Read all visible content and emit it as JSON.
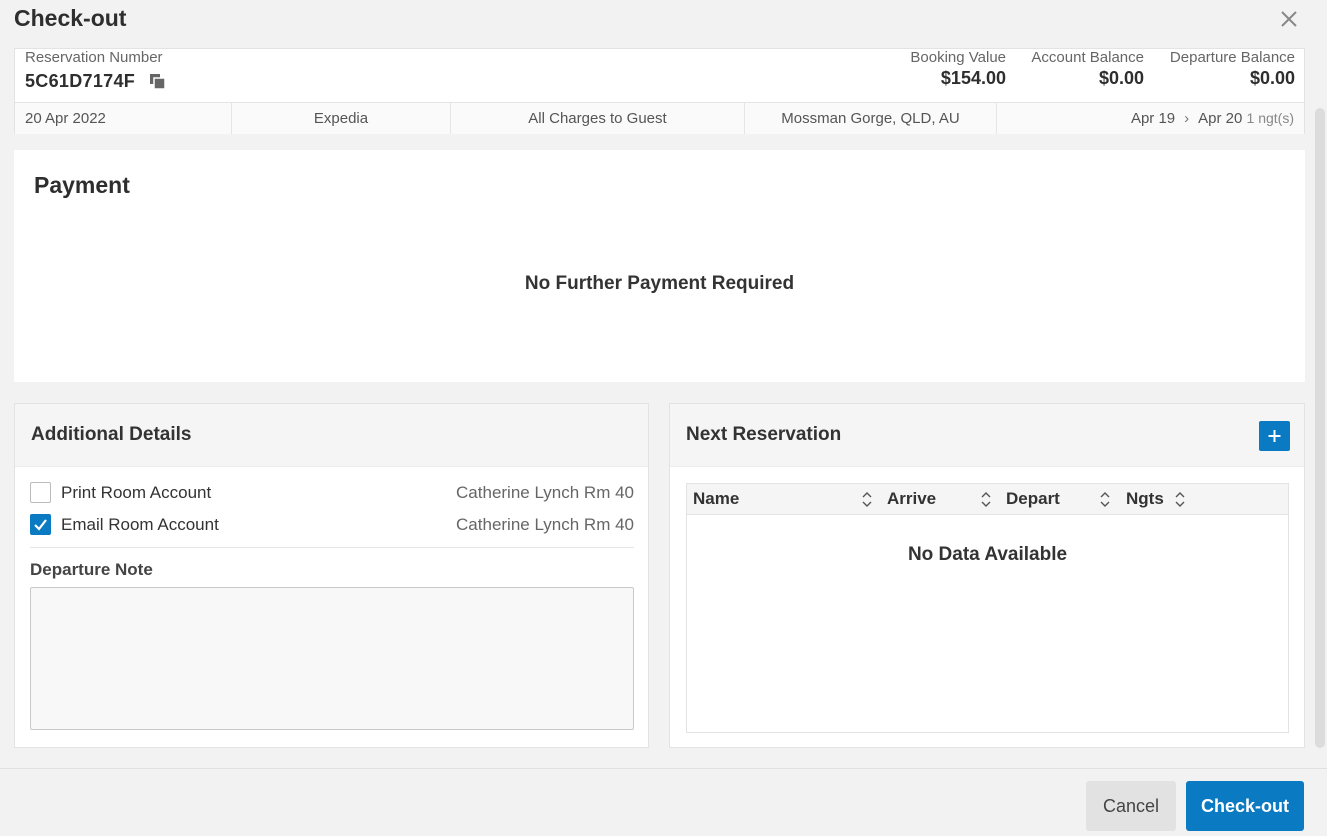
{
  "dialog": {
    "title": "Check-out"
  },
  "reservation": {
    "number_label": "Reservation Number",
    "number": "5C61D7174F",
    "booking_value_label": "Booking Value",
    "booking_value": "$154.00",
    "account_balance_label": "Account Balance",
    "account_balance": "$0.00",
    "departure_balance_label": "Departure Balance",
    "departure_balance": "$0.00",
    "date": "20 Apr 2022",
    "agent": "Expedia",
    "charges": "All Charges to Guest",
    "location": "Mossman Gorge, QLD, AU",
    "arrive": "Apr 19",
    "depart": "Apr 20",
    "nights": "1 ngt(s)"
  },
  "payment": {
    "title": "Payment",
    "message": "No Further Payment Required"
  },
  "additional_details": {
    "title": "Additional Details",
    "print_label": "Print Room Account",
    "print_checked": false,
    "print_guest": "Catherine Lynch Rm 40",
    "email_label": "Email Room Account",
    "email_checked": true,
    "email_guest": "Catherine Lynch Rm 40",
    "note_label": "Departure Note",
    "note_value": ""
  },
  "next_reservation": {
    "title": "Next Reservation",
    "columns": [
      "Name",
      "Arrive",
      "Depart",
      "Ngts"
    ],
    "empty_message": "No Data Available"
  },
  "footer": {
    "cancel_label": "Cancel",
    "checkout_label": "Check-out"
  },
  "colors": {
    "primary": "#0a7ac3",
    "background": "#f2f2f2"
  },
  "icons": {
    "close": "close-icon",
    "copy": "copy-icon",
    "add": "plus-icon",
    "sort": "sort-icon",
    "check": "check-icon",
    "chevron": "chevron-right-icon"
  }
}
